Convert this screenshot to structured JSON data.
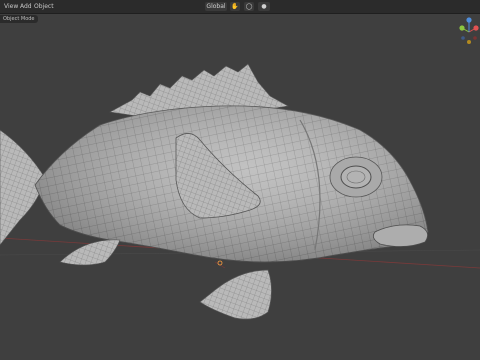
{
  "header": {
    "menus": [
      "View",
      "Add",
      "Object"
    ],
    "shading_label": "Global",
    "mode_badge": "Object Mode"
  },
  "gizmo": {
    "axes": [
      {
        "name": "X",
        "color": "#e25252"
      },
      {
        "name": "Y",
        "color": "#8cc63f"
      },
      {
        "name": "Z",
        "color": "#4f8edc"
      }
    ]
  },
  "colors": {
    "background": "#3f3f3f",
    "mesh_fill": "#b5b5b5",
    "mesh_wire": "#5a5a5a",
    "grid_red": "#8a3a3a"
  },
  "icons": [
    "hand-icon",
    "circle-icon",
    "sphere-shading-icon",
    "settings-icon"
  ],
  "scene": {
    "object": "fish-mesh"
  }
}
